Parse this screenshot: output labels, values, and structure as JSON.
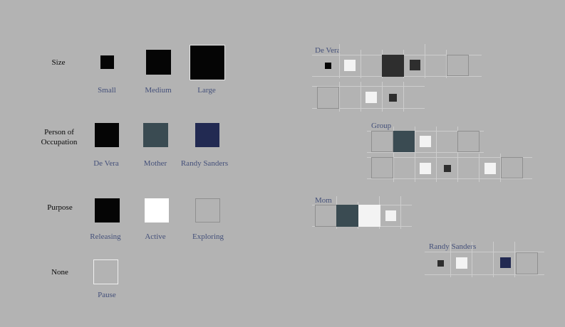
{
  "legend": {
    "size": {
      "title": "Size",
      "items": [
        {
          "label": "Small"
        },
        {
          "label": "Medium"
        },
        {
          "label": "Large"
        }
      ]
    },
    "occupation": {
      "title_line1": "Person of",
      "title_line2": "Occupation",
      "items": [
        {
          "label": "De Vera",
          "color": "#050505"
        },
        {
          "label": "Mother",
          "color": "#3a4b52"
        },
        {
          "label": "Randy Sanders",
          "color": "#222a52"
        }
      ]
    },
    "purpose": {
      "title": "Purpose",
      "items": [
        {
          "label": "Releasing",
          "style": "filled-black"
        },
        {
          "label": "Active",
          "style": "filled-white"
        },
        {
          "label": "Exploring",
          "style": "outline"
        }
      ]
    },
    "none": {
      "title": "None",
      "items": [
        {
          "label": "Pause",
          "style": "outline-white"
        }
      ]
    }
  },
  "timelines": [
    {
      "title": "De Vera"
    },
    {
      "title": "Group"
    },
    {
      "title": "Mom"
    },
    {
      "title": "Randy Sanders"
    }
  ]
}
